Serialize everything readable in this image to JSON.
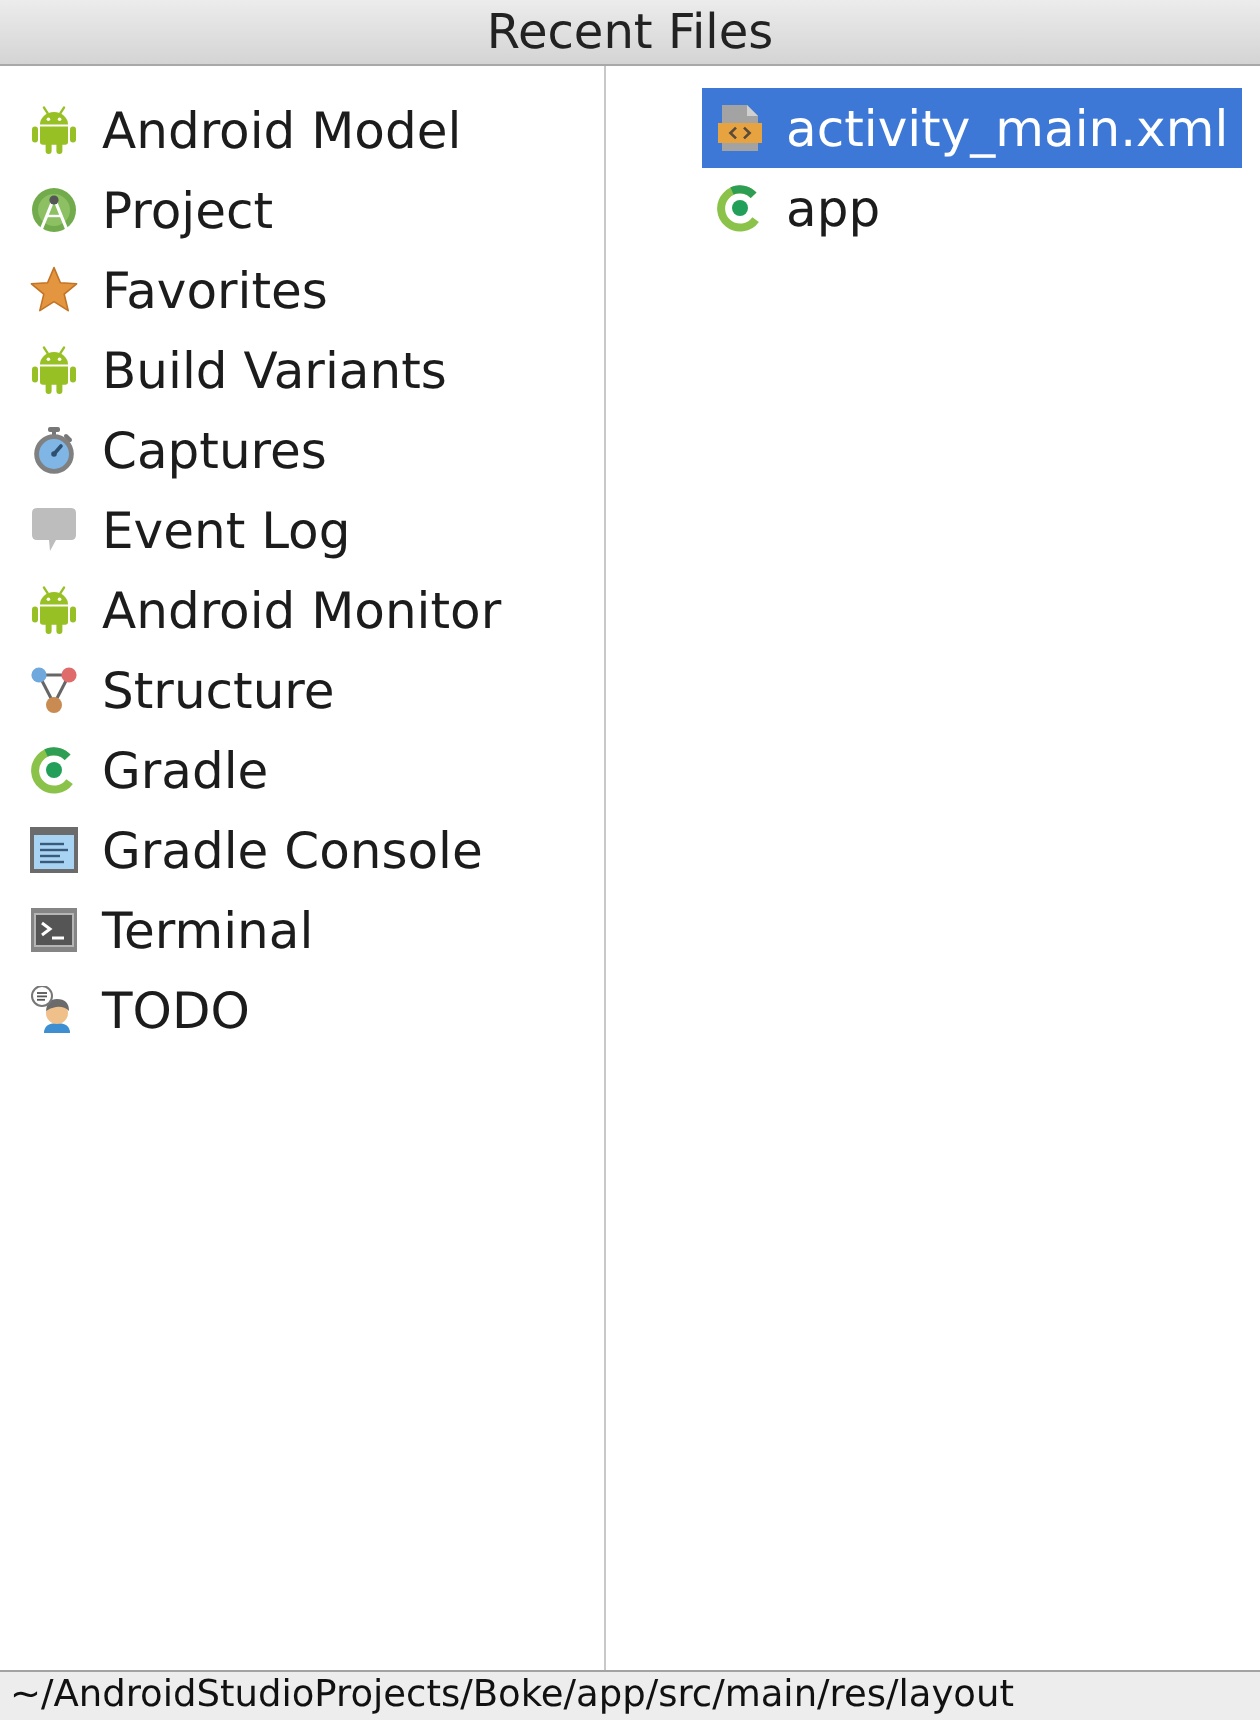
{
  "window": {
    "title": "Recent Files"
  },
  "tool_windows": [
    {
      "label": "Android Model",
      "kind": "android",
      "selected": false
    },
    {
      "label": "Project",
      "kind": "project",
      "selected": false
    },
    {
      "label": "Favorites",
      "kind": "star",
      "selected": false
    },
    {
      "label": "Build Variants",
      "kind": "android",
      "selected": false
    },
    {
      "label": "Captures",
      "kind": "stopwatch",
      "selected": false
    },
    {
      "label": "Event Log",
      "kind": "bubble",
      "selected": false
    },
    {
      "label": "Android Monitor",
      "kind": "android",
      "selected": false
    },
    {
      "label": "Structure",
      "kind": "structure",
      "selected": false
    },
    {
      "label": "Gradle",
      "kind": "ring",
      "selected": false
    },
    {
      "label": "Gradle Console",
      "kind": "console",
      "selected": false
    },
    {
      "label": "Terminal",
      "kind": "terminal",
      "selected": false
    },
    {
      "label": "TODO",
      "kind": "todo",
      "selected": false
    }
  ],
  "recent_files": [
    {
      "label": "activity_main.xml",
      "kind": "xml",
      "selected": true
    },
    {
      "label": "app",
      "kind": "ring",
      "selected": false
    }
  ],
  "status_bar": {
    "path": "~/AndroidStudioProjects/Boke/app/src/main/res/layout"
  }
}
